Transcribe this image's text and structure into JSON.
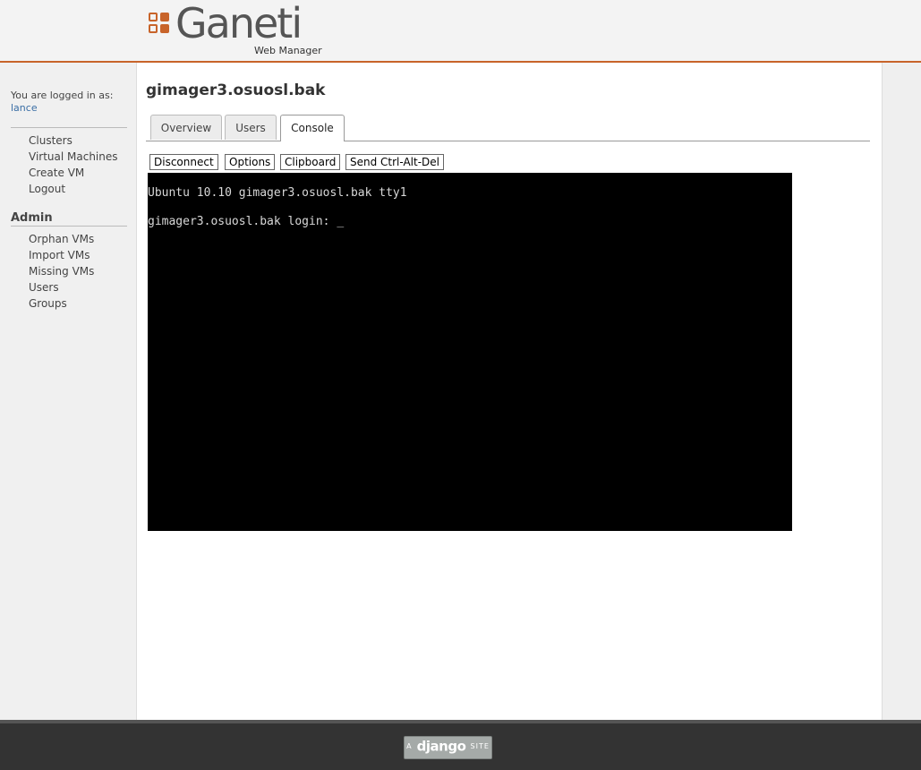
{
  "header": {
    "logo_text": "Ganeti",
    "logo_subtitle": "Web Manager",
    "accent_color": "#c8642a"
  },
  "sidebar": {
    "logged_in_label": "You are logged in as:",
    "username": "lance",
    "nav": [
      {
        "label": "Clusters"
      },
      {
        "label": "Virtual Machines"
      },
      {
        "label": "Create VM"
      },
      {
        "label": "Logout"
      }
    ],
    "admin_heading": "Admin",
    "admin_nav": [
      {
        "label": "Orphan VMs"
      },
      {
        "label": "Import VMs"
      },
      {
        "label": "Missing VMs"
      },
      {
        "label": "Users"
      },
      {
        "label": "Groups"
      }
    ]
  },
  "main": {
    "title": "gimager3.osuosl.bak",
    "tabs": [
      {
        "label": "Overview",
        "active": false
      },
      {
        "label": "Users",
        "active": false
      },
      {
        "label": "Console",
        "active": true
      }
    ],
    "console_buttons": [
      {
        "label": "Disconnect"
      },
      {
        "label": "Options"
      },
      {
        "label": "Clipboard"
      },
      {
        "label": "Send Ctrl-Alt-Del"
      }
    ],
    "console": {
      "line1": "Ubuntu 10.10 gimager3.osuosl.bak tty1",
      "line2": "gimager3.osuosl.bak login: _"
    }
  },
  "footer": {
    "badge_prefix": "A",
    "badge_main": "django",
    "badge_suffix": "SITE"
  }
}
